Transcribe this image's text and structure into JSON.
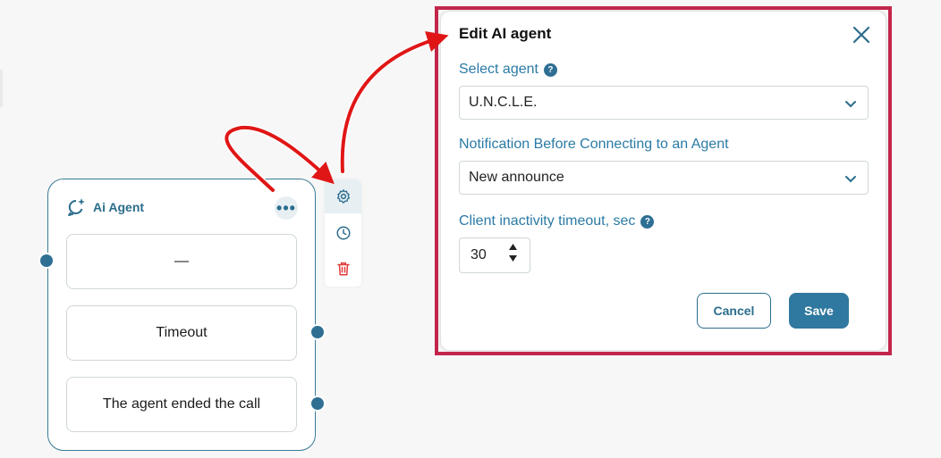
{
  "node": {
    "title": "Ai Agent",
    "exits": [
      "—",
      "Timeout",
      "The agent ended the call"
    ]
  },
  "toolbar": {
    "items": [
      {
        "icon": "gear-icon",
        "active": true
      },
      {
        "icon": "clock-icon",
        "active": false
      },
      {
        "icon": "trash-icon",
        "active": false
      }
    ]
  },
  "modal": {
    "title": "Edit AI agent",
    "select_agent": {
      "label": "Select agent",
      "value": "U.N.C.L.E."
    },
    "notification": {
      "label": "Notification Before Connecting to an Agent",
      "value": "New announce"
    },
    "timeout": {
      "label": "Client inactivity timeout, sec",
      "value": "30"
    },
    "help_glyph": "?",
    "cancel_label": "Cancel",
    "save_label": "Save"
  },
  "colors": {
    "accent": "#2b7aa5",
    "port": "#2f6f93",
    "highlight": "#c3264a",
    "arrow": "#e01616",
    "delete": "#e03a3a"
  }
}
